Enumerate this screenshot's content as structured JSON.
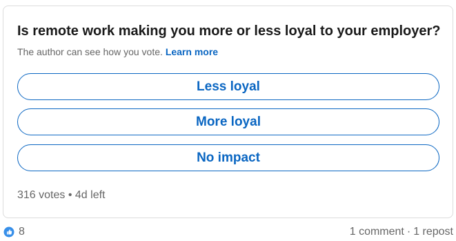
{
  "poll": {
    "question": "Is remote work making you more or less loyal to your employer?",
    "note": "The author can see how you vote.",
    "learn_more": "Learn more",
    "options": [
      {
        "label": "Less loyal"
      },
      {
        "label": "More loyal"
      },
      {
        "label": "No impact"
      }
    ],
    "votes": "316 votes",
    "separator": "•",
    "time_left": "4d left"
  },
  "social": {
    "reaction_icon": "like-icon",
    "reaction_count": "8",
    "comments": "1 comment",
    "separator": "·",
    "reposts": "1 repost"
  },
  "colors": {
    "accent": "#0a66c2",
    "text_primary": "#191919",
    "text_secondary": "#666666",
    "border": "#dcdcdc"
  }
}
